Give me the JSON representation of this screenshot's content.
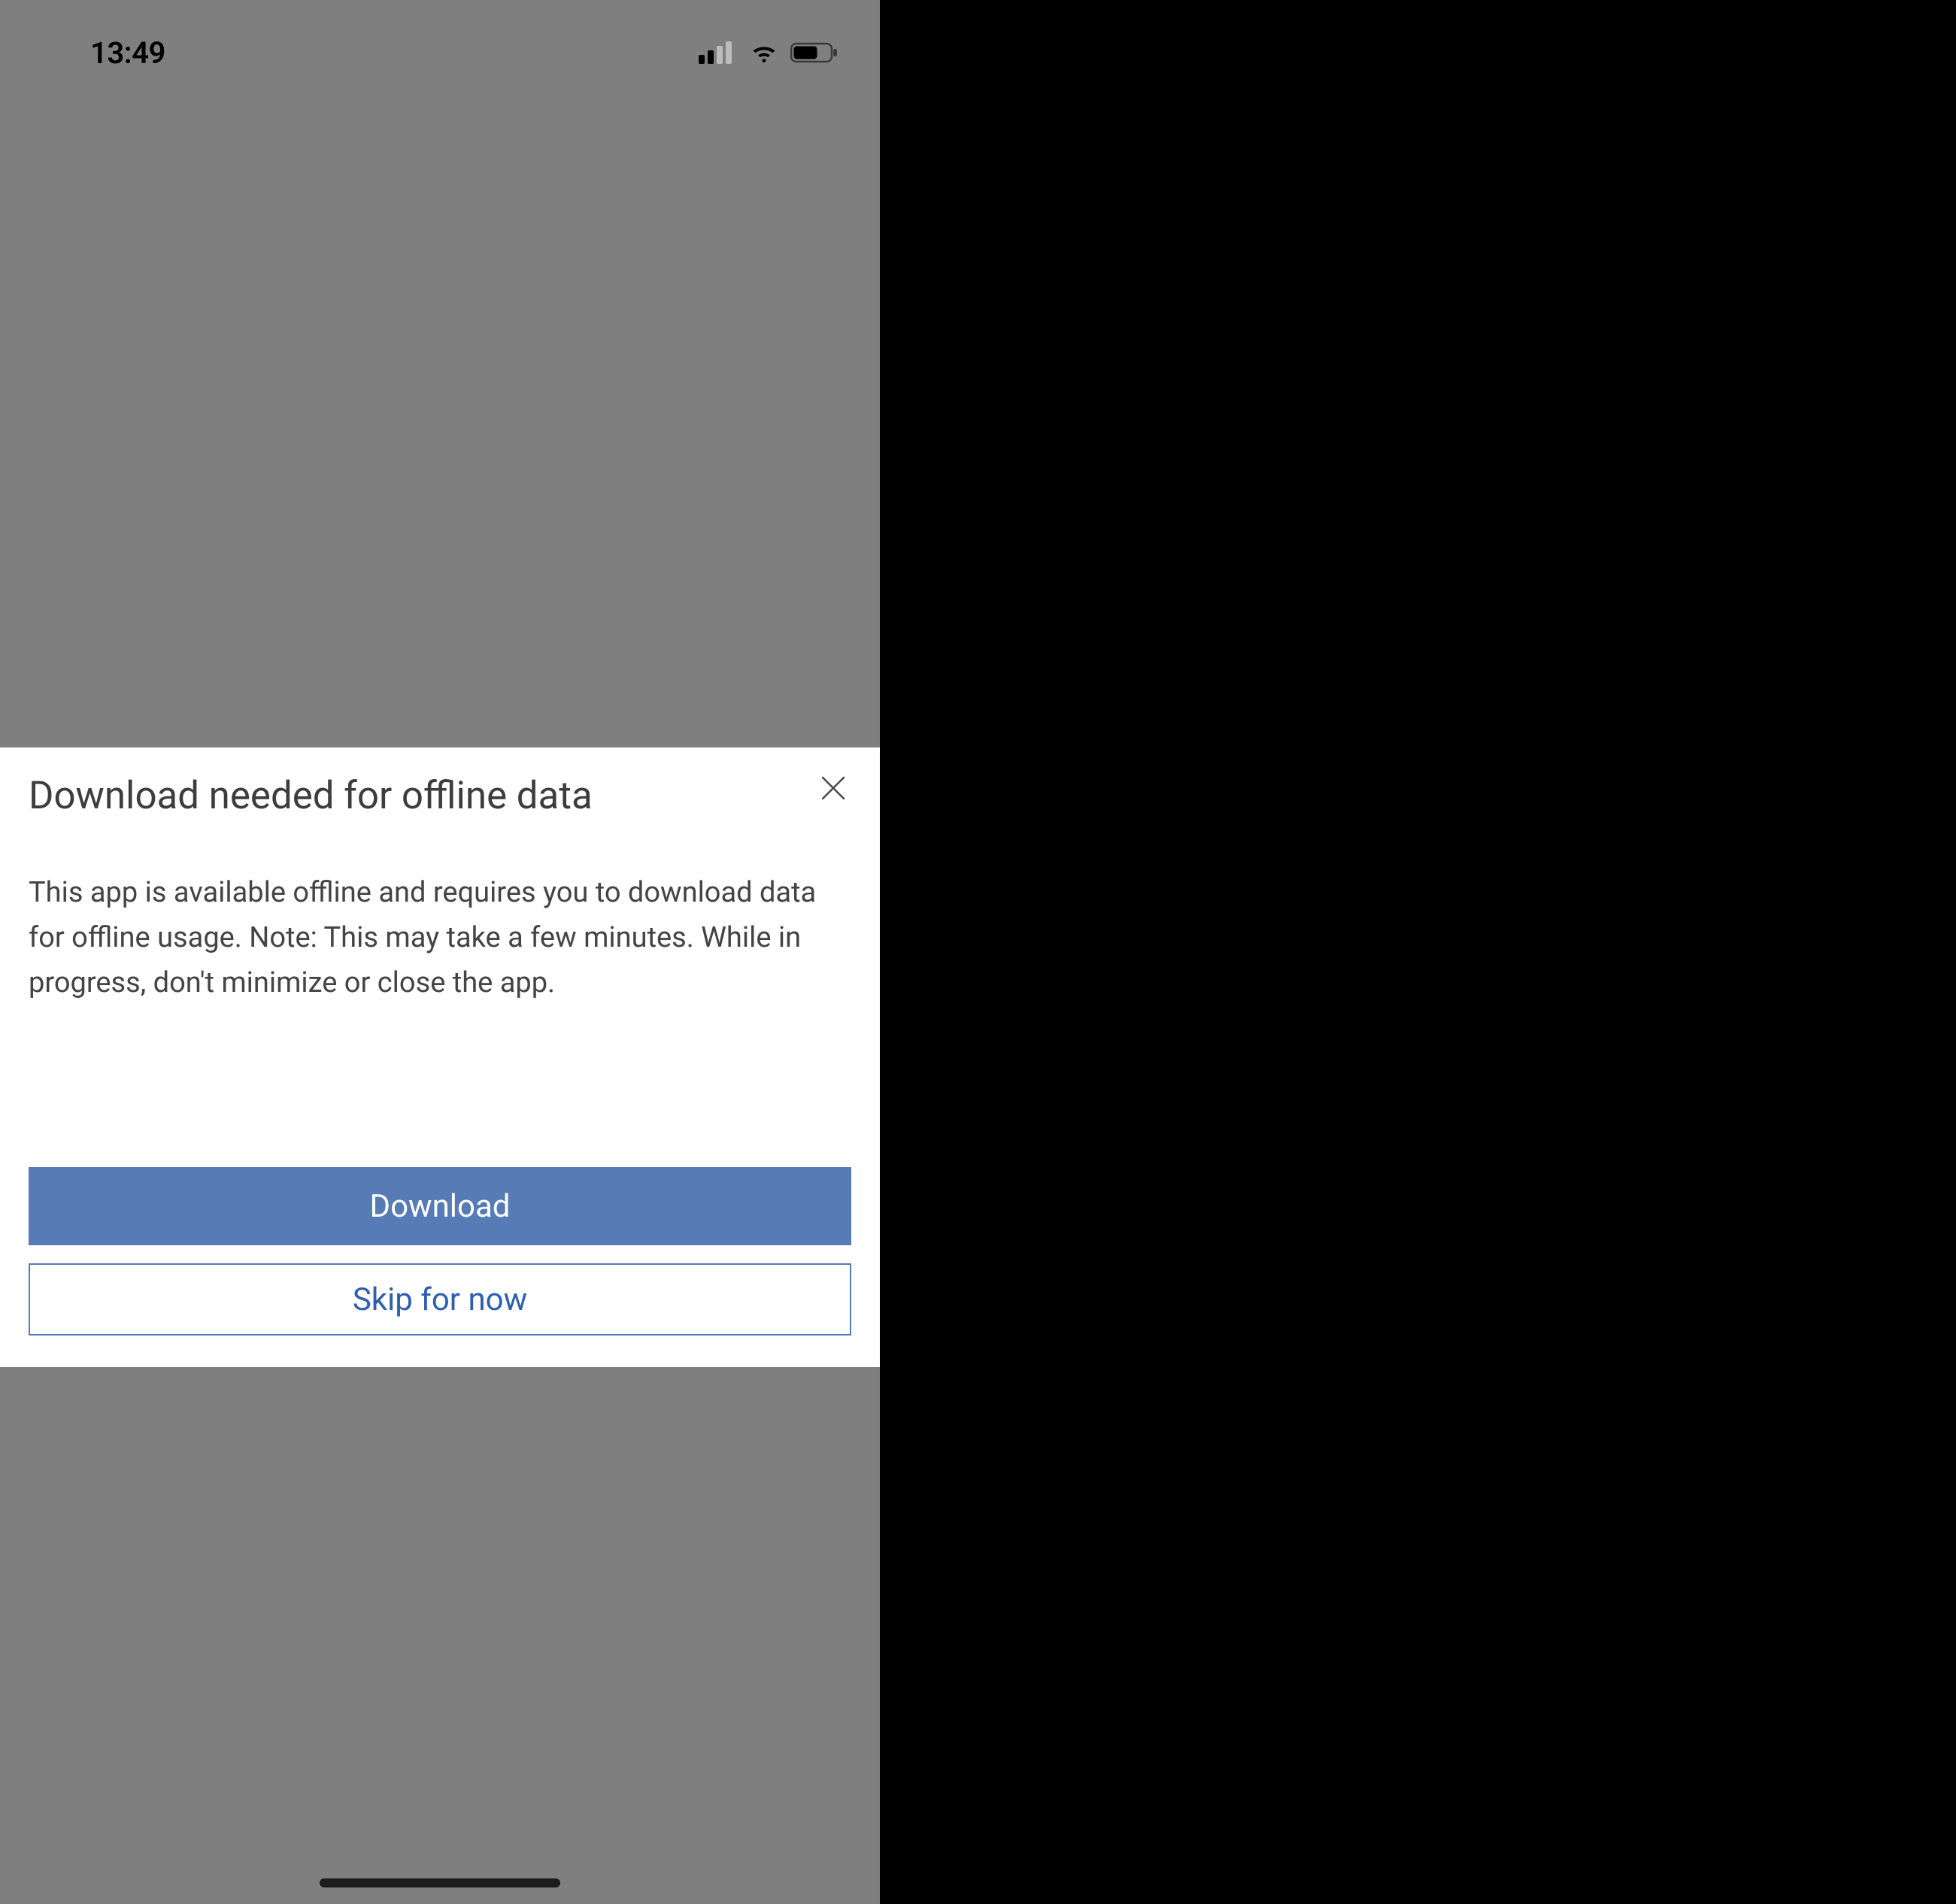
{
  "status_bar": {
    "time": "13:49"
  },
  "dialog": {
    "title": "Download needed for offline data",
    "body": "This app is available offline and requires you to download data for offline usage. Note: This may take a few minutes. While in progress, don't minimize or close the app.",
    "download_label": "Download",
    "skip_label": "Skip for now"
  }
}
